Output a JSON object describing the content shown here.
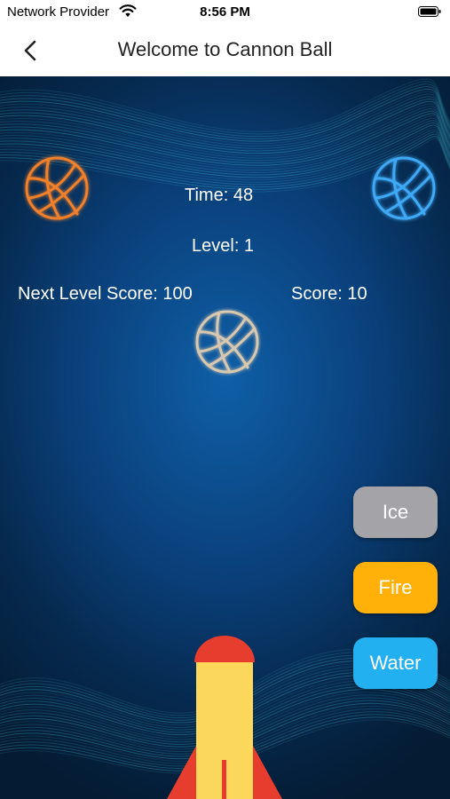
{
  "status_bar": {
    "carrier": "Network Provider",
    "time": "8:56 PM"
  },
  "nav": {
    "title": "Welcome to Cannon Ball",
    "back_icon": "chevron-left-icon"
  },
  "hud": {
    "time_label": "Time: 48",
    "level_label": "Level: 1",
    "next_level_label": "Next Level Score: 100",
    "score_label": "Score: 10"
  },
  "balls": [
    {
      "name": "orange-ball",
      "color": "#f0802a"
    },
    {
      "name": "blue-ball",
      "color": "#3fa9f5"
    },
    {
      "name": "beige-ball",
      "color": "#d8c8b0"
    }
  ],
  "buttons": {
    "ice": {
      "label": "Ice",
      "color": "#a3a3a8"
    },
    "fire": {
      "label": "Fire",
      "color": "#ffb10a"
    },
    "water": {
      "label": "Water",
      "color": "#23b0f0"
    }
  },
  "cannon": {
    "body_color": "#fbd85c",
    "nose_color": "#e63d2f",
    "icon": "rocket-cannon-icon"
  }
}
